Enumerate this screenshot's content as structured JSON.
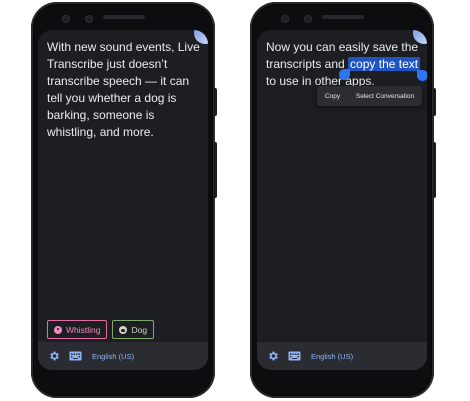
{
  "screens": [
    {
      "transcript": "With new sound events, Live Transcribe just doesn’t transcribe speech — it can tell you whether a dog is barking, someone is whistling, and more.",
      "sound_chips": [
        {
          "label": "Whistling",
          "icon": "whistle-icon",
          "color": "#f08ac0"
        },
        {
          "label": "Dog",
          "icon": "dog-icon",
          "color": "#80a96f"
        }
      ],
      "language": "English (US)"
    },
    {
      "transcript_before": "Now you can easily save the transcripts and ",
      "transcript_selected": "copy the text",
      "transcript_after": " to use in other apps.",
      "context_menu": [
        "Copy",
        "Select Conversation"
      ],
      "language": "English (US)"
    }
  ],
  "colors": {
    "screen_bg": "#1d1e22",
    "bottom_bar": "#2b2c31",
    "selection": "#1f55c2",
    "accent_blue": "#8fb4f5"
  }
}
